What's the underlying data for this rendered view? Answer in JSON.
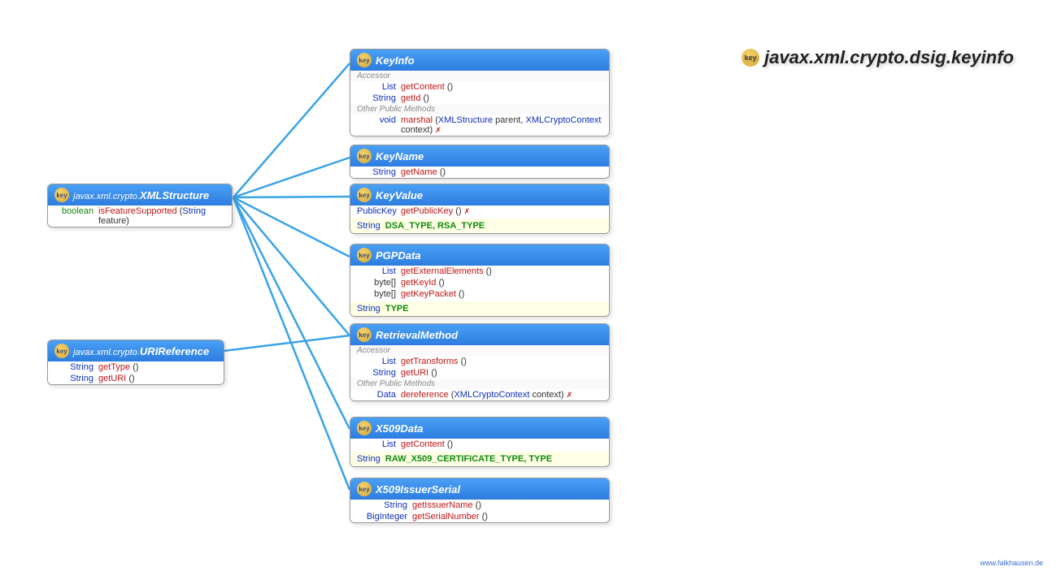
{
  "title": "javax.xml.crypto.dsig.keyinfo",
  "footer": "www.falkhausen.de",
  "leftBoxes": {
    "xmlStructure": {
      "package": "javax.xml.crypto.",
      "name": "XMLStructure",
      "method": {
        "ret": "boolean",
        "name": "isFeatureSupported",
        "paramType": "String",
        "paramName": "feature"
      }
    },
    "uriReference": {
      "package": "javax.xml.crypto.",
      "name": "URIReference",
      "methods": [
        {
          "ret": "String",
          "name": "getType"
        },
        {
          "ret": "String",
          "name": "getURI"
        }
      ]
    }
  },
  "rightBoxes": {
    "keyInfo": {
      "name": "KeyInfo",
      "sectionA": "Accessor",
      "methods1": [
        {
          "ret": "List",
          "name": "getContent"
        },
        {
          "ret": "String",
          "name": "getId"
        }
      ],
      "sectionB": "Other Public Methods",
      "method2": {
        "ret": "void",
        "name": "marshal",
        "paramTypes": [
          "XMLStructure",
          "XMLCryptoContext"
        ],
        "paramNames": [
          "parent",
          "context"
        ],
        "throws": true
      }
    },
    "keyName": {
      "name": "KeyName",
      "methods": [
        {
          "ret": "String",
          "name": "getName"
        }
      ]
    },
    "keyValue": {
      "name": "KeyValue",
      "methods": [
        {
          "ret": "PublicKey",
          "name": "getPublicKey",
          "throws": true
        }
      ],
      "constants": {
        "type": "String",
        "names": "DSA_TYPE, RSA_TYPE"
      }
    },
    "pgpData": {
      "name": "PGPData",
      "methods": [
        {
          "ret": "List",
          "name": "getExternalElements"
        },
        {
          "ret": "byte[]",
          "name": "getKeyId"
        },
        {
          "ret": "byte[]",
          "name": "getKeyPacket"
        }
      ],
      "constants": {
        "type": "String",
        "names": "TYPE"
      }
    },
    "retrievalMethod": {
      "name": "RetrievalMethod",
      "sectionA": "Accessor",
      "methods1": [
        {
          "ret": "List",
          "name": "getTransforms"
        },
        {
          "ret": "String",
          "name": "getURI"
        }
      ],
      "sectionB": "Other Public Methods",
      "method2": {
        "ret": "Data",
        "name": "dereference",
        "paramTypes": [
          "XMLCryptoContext"
        ],
        "paramNames": [
          "context"
        ],
        "throws": true
      }
    },
    "x509Data": {
      "name": "X509Data",
      "methods": [
        {
          "ret": "List",
          "name": "getContent"
        }
      ],
      "constants": {
        "type": "String",
        "names": "RAW_X509_CERTIFICATE_TYPE, TYPE"
      }
    },
    "x509IssuerSerial": {
      "name": "X509IssuerSerial",
      "methods": [
        {
          "ret": "String",
          "name": "getIssuerName"
        },
        {
          "ret": "BigInteger",
          "name": "getSerialNumber"
        }
      ]
    }
  }
}
